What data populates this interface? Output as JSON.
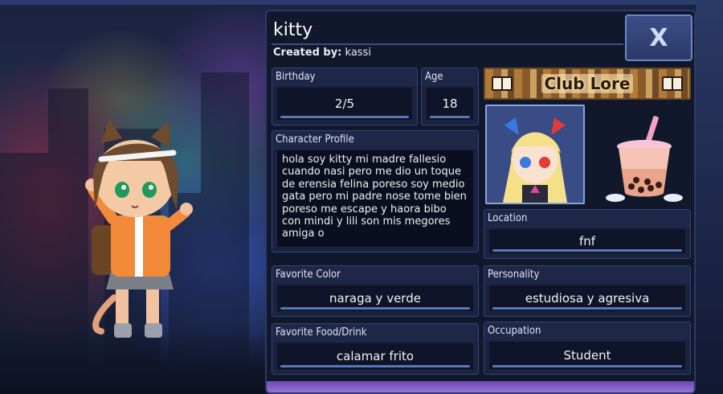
{
  "character": {
    "name": "kitty",
    "created_by_label": "Created by:",
    "created_by": "kassi"
  },
  "close_button": {
    "label": "X"
  },
  "club_lore": {
    "label": "Club Lore"
  },
  "fields": {
    "birthday": {
      "label": "Birthday",
      "value": "2/5"
    },
    "age": {
      "label": "Age",
      "value": "18"
    },
    "profile": {
      "label": "Character Profile",
      "value": "hola soy kitty mi madre fallesio cuando nasi pero me dio un toque de erensia felina poreso soy medio gata pero mi padre nose tome bien poreso me escape y haora bibo con mindi y lili son mis megores amiga o"
    },
    "location": {
      "label": "Location",
      "value": "fnf"
    },
    "favorite_color": {
      "label": "Favorite Color",
      "value": "naraga y verde"
    },
    "personality": {
      "label": "Personality",
      "value": "estudiosa y agresiva"
    },
    "favorite_food": {
      "label": "Favorite Food/Drink",
      "value": "calamar frito"
    },
    "occupation": {
      "label": "Occupation",
      "value": "Student"
    }
  },
  "icons": {
    "close": "close-icon",
    "book": "book-icon",
    "boba": "boba-tea-icon",
    "portrait": "character-portrait"
  },
  "colors": {
    "panel_bg": "#12182b",
    "field_border": "#34447a",
    "accent_underline": "#5a76b8",
    "bottom_bar": "#9a6fdc"
  }
}
